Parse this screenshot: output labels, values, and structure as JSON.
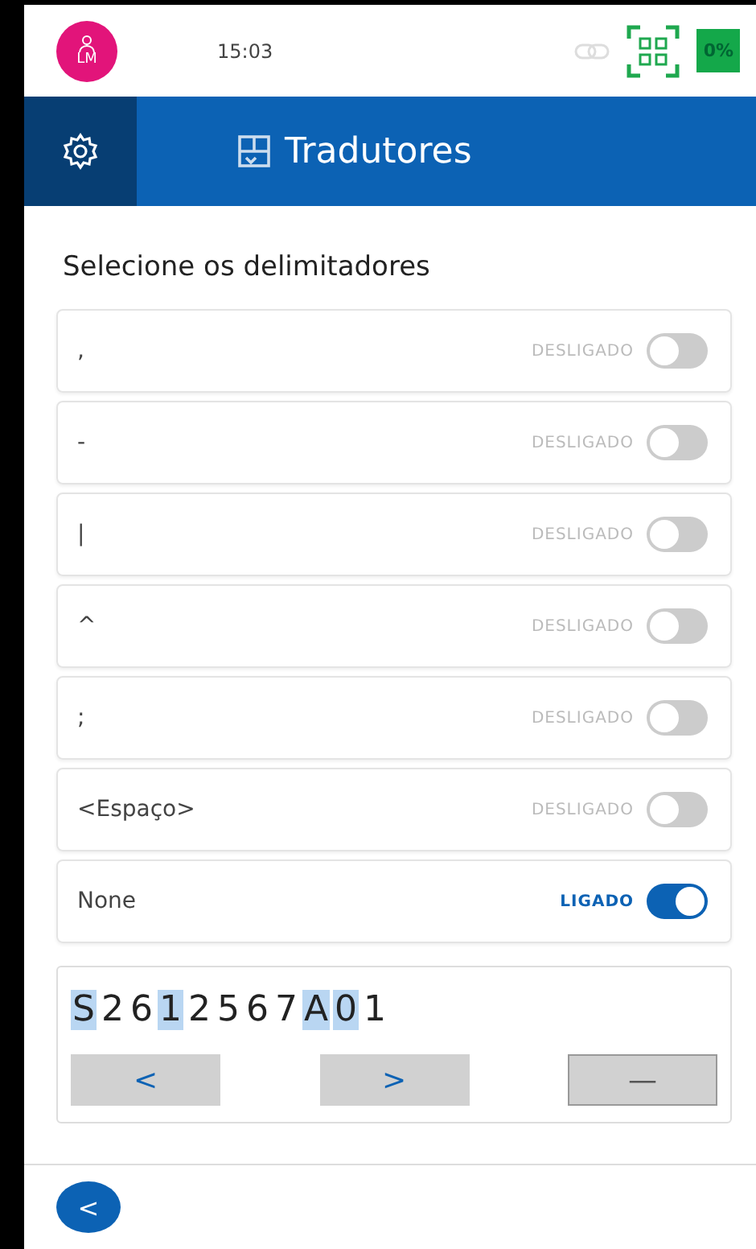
{
  "status_bar": {
    "avatar_initials": "LM",
    "time": "15:03",
    "battery": "0%"
  },
  "header": {
    "title": "Tradutores"
  },
  "section_title": "Selecione os delimitadores",
  "delimiters": [
    {
      "label": ",",
      "state_text": "DESLIGADO",
      "on": false
    },
    {
      "label": "-",
      "state_text": "DESLIGADO",
      "on": false
    },
    {
      "label": "|",
      "state_text": "DESLIGADO",
      "on": false
    },
    {
      "label": "^",
      "state_text": "DESLIGADO",
      "on": false
    },
    {
      "label": ";",
      "state_text": "DESLIGADO",
      "on": false
    },
    {
      "label": "<Espaço>",
      "state_text": "DESLIGADO",
      "on": false
    },
    {
      "label": "None",
      "state_text": "LIGADO",
      "on": true
    }
  ],
  "barcode": {
    "characters": [
      {
        "char": "S",
        "selected": true
      },
      {
        "char": "2",
        "selected": false
      },
      {
        "char": "6",
        "selected": false
      },
      {
        "char": "1",
        "selected": true
      },
      {
        "char": "2",
        "selected": false
      },
      {
        "char": "5",
        "selected": false
      },
      {
        "char": "6",
        "selected": false
      },
      {
        "char": "7",
        "selected": false
      },
      {
        "char": "A",
        "selected": true
      },
      {
        "char": "0",
        "selected": true
      },
      {
        "char": "1",
        "selected": false
      }
    ],
    "buttons": [
      {
        "label": "<",
        "kind": "prev"
      },
      {
        "label": ">",
        "kind": "next"
      },
      {
        "label": "—",
        "kind": "remove"
      }
    ]
  },
  "back_button": {
    "label": "<"
  }
}
